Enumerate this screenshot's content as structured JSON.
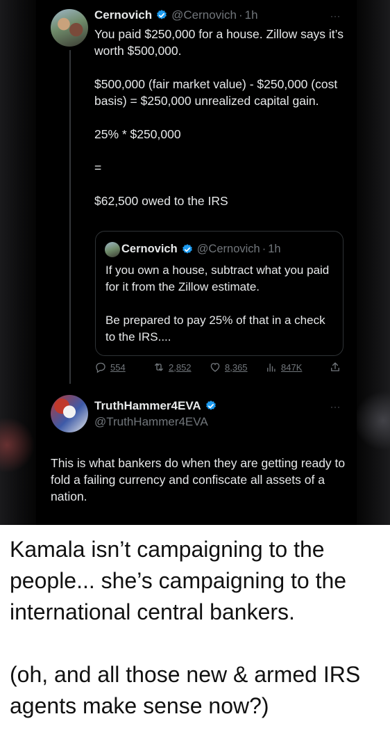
{
  "post": {
    "author_name": "Cernovich",
    "author_handle": "@Cernovich",
    "separator": "·",
    "time": "1h",
    "more_glyph": "···",
    "paragraphs": [
      "You paid $250,000 for a house. Zillow says it’s worth $500,000.",
      "$500,000 (fair market value) - $250,000 (cost basis) = $250,000 unrealized capital gain.",
      "25% * $250,000",
      "=",
      "$62,500 owed to the IRS"
    ],
    "quoted": {
      "author_name": "Cernovich",
      "author_handle": "@Cernovich",
      "separator": "·",
      "time": "1h",
      "paragraphs": [
        "If you own a house, subtract what you paid for it from the Zillow estimate.",
        "Be prepared to pay 25% of that in a check to the IRS...."
      ]
    },
    "actions": {
      "replies": "554",
      "reposts": "2,852",
      "likes": "8,365",
      "views": "847K"
    }
  },
  "reply": {
    "author_name": "TruthHammer4EVA",
    "author_handle": "@TruthHammer4EVA",
    "more_glyph": "···",
    "paragraphs": [
      "This is what bankers do when they are getting ready to fold a failing currency and confiscate all assets of a nation."
    ]
  },
  "caption": {
    "paragraphs": [
      "Kamala isn’t campaigning to the people... she’s campaigning to the international central bankers.",
      "(oh, and all those new & armed IRS agents make sense now?)"
    ]
  },
  "colors": {
    "background": "#000000",
    "text": "#e7e9ea",
    "muted": "#71767b",
    "verified": "#1d9bf0",
    "border": "#2f3336",
    "caption_text": "#111111"
  },
  "icons": {
    "verified": "verified-badge-icon",
    "reply": "reply-icon",
    "repost": "repost-icon",
    "like": "like-icon",
    "views": "views-icon",
    "share": "share-icon",
    "more": "more-icon"
  }
}
